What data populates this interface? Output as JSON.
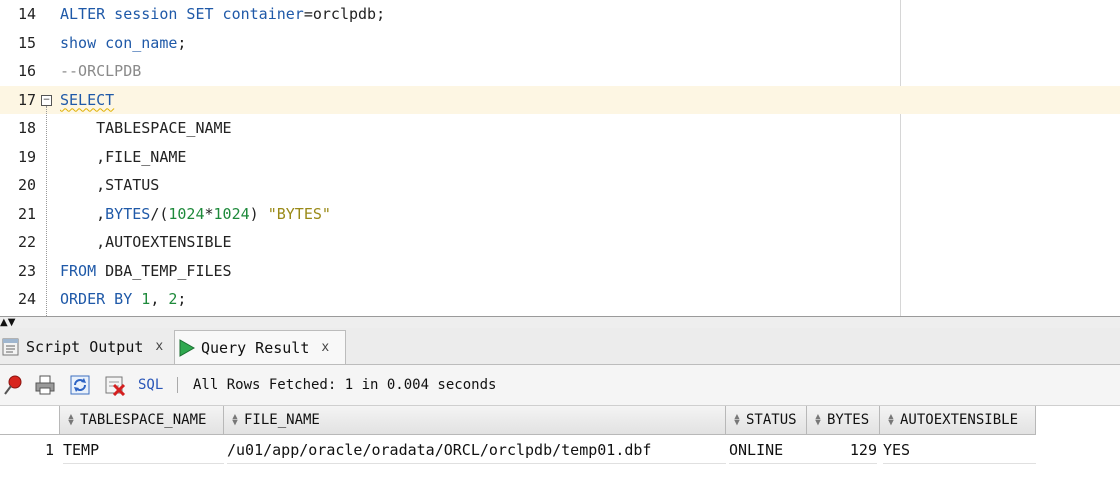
{
  "editor": {
    "lines": [
      {
        "n": "14",
        "tokens": [
          {
            "t": "ALTER session SET container",
            "c": "kw"
          },
          {
            "t": "=orclpdb;",
            "c": ""
          }
        ]
      },
      {
        "n": "15",
        "tokens": [
          {
            "t": "show con_name",
            "c": "kw"
          },
          {
            "t": ";",
            "c": ""
          }
        ]
      },
      {
        "n": "16",
        "tokens": [
          {
            "t": "--ORCLPDB",
            "c": "cm"
          }
        ]
      },
      {
        "n": "17",
        "current": true,
        "fold": "⊟",
        "tokens": [
          {
            "t": "SELECT",
            "c": "kw squig"
          }
        ]
      },
      {
        "n": "18",
        "tokens": [
          {
            "t": "    TABLESPACE_NAME",
            "c": ""
          }
        ]
      },
      {
        "n": "19",
        "tokens": [
          {
            "t": "    ,FILE_NAME",
            "c": ""
          }
        ]
      },
      {
        "n": "20",
        "tokens": [
          {
            "t": "    ,STATUS",
            "c": ""
          }
        ]
      },
      {
        "n": "21",
        "tokens": [
          {
            "t": "    ,",
            "c": ""
          },
          {
            "t": "BYTES",
            "c": "kw"
          },
          {
            "t": "/(",
            "c": ""
          },
          {
            "t": "1024",
            "c": "num"
          },
          {
            "t": "*",
            "c": ""
          },
          {
            "t": "1024",
            "c": "num"
          },
          {
            "t": ") ",
            "c": ""
          },
          {
            "t": "\"BYTES\"",
            "c": "str"
          }
        ]
      },
      {
        "n": "22",
        "tokens": [
          {
            "t": "    ,AUTOEXTENSIBLE",
            "c": ""
          }
        ]
      },
      {
        "n": "23",
        "tokens": [
          {
            "t": "FROM",
            "c": "kw"
          },
          {
            "t": " DBA_TEMP_FILES",
            "c": ""
          }
        ]
      },
      {
        "n": "24",
        "tokens": [
          {
            "t": "ORDER BY",
            "c": "kw"
          },
          {
            "t": " ",
            "c": ""
          },
          {
            "t": "1",
            "c": "num"
          },
          {
            "t": ", ",
            "c": ""
          },
          {
            "t": "2",
            "c": "num"
          },
          {
            "t": ";",
            "c": ""
          }
        ]
      }
    ]
  },
  "splitter": {
    "arrows": "▲▼"
  },
  "tabs": [
    {
      "label": "Script Output",
      "close": "x",
      "icon": "script-output-icon"
    },
    {
      "label": "Query Result",
      "close": "x",
      "icon": "run-query-icon"
    }
  ],
  "toolbar": {
    "icons": [
      "pin-icon",
      "print-icon",
      "refresh-icon",
      "delete-icon"
    ],
    "sql_label": "SQL",
    "status": "All Rows Fetched: 1 in 0.004 seconds"
  },
  "grid": {
    "columns": [
      "TABLESPACE_NAME",
      "FILE_NAME",
      "STATUS",
      "BYTES",
      "AUTOEXTENSIBLE"
    ],
    "rows": [
      {
        "num": "1",
        "cells": [
          "TEMP",
          "/u01/app/oracle/oradata/ORCL/orclpdb/temp01.dbf",
          "ONLINE",
          "129",
          "YES"
        ]
      }
    ]
  },
  "colors": {
    "keyword": "#1f59a8",
    "number": "#1e8a3b",
    "string": "#9a8a18",
    "comment": "#8a8a8a",
    "current_line": "#fdf6e3"
  }
}
